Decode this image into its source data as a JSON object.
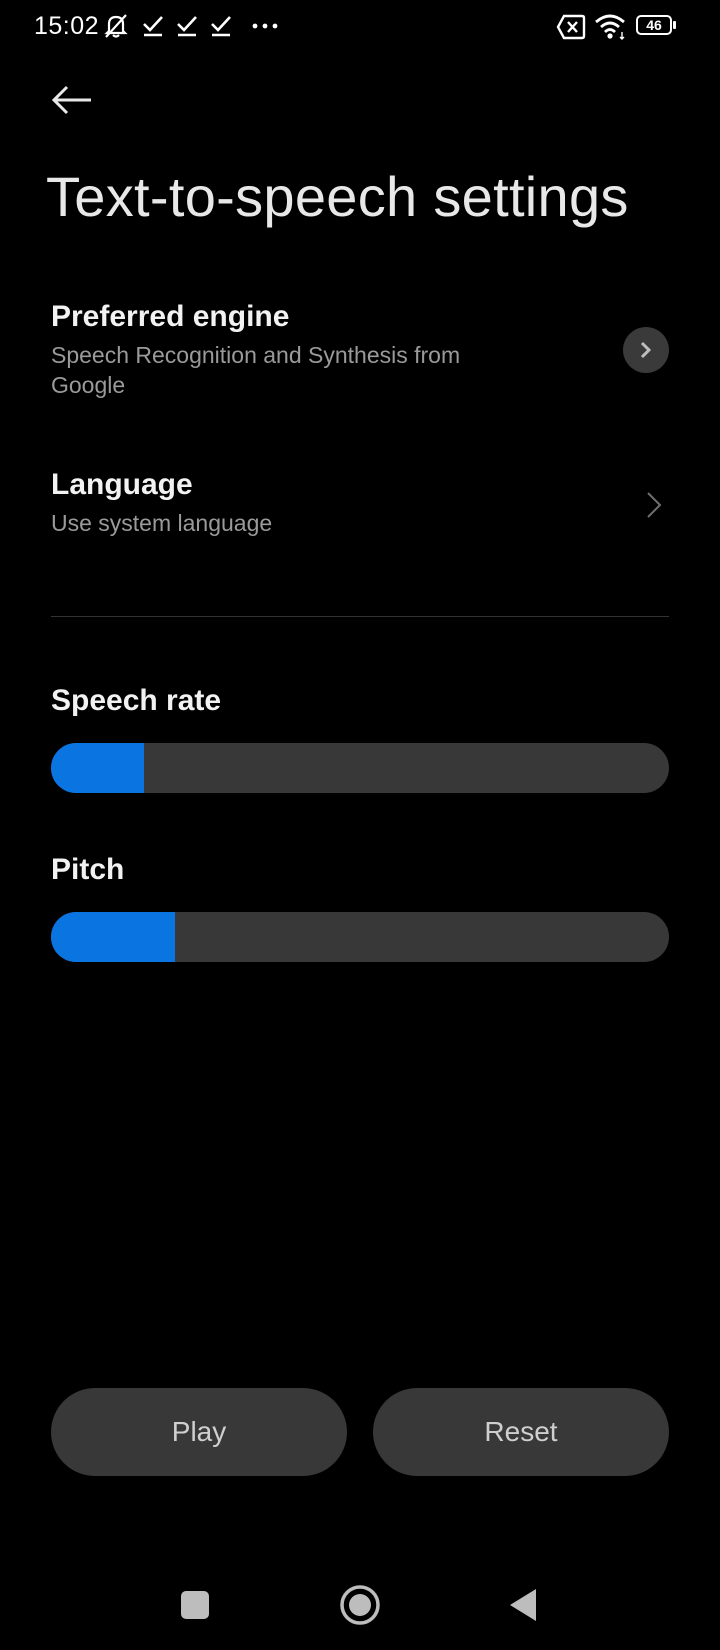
{
  "status_bar": {
    "time": "15:02",
    "battery": "46",
    "left_icons": [
      "muted-bell-icon",
      "check-icon",
      "check-icon",
      "check-icon",
      "more-dots-icon"
    ],
    "right_icons": [
      "sim-x-icon",
      "wifi-icon",
      "battery-icon"
    ]
  },
  "header": {
    "title": "Text-to-speech settings"
  },
  "settings": {
    "preferred_engine": {
      "title": "Preferred engine",
      "value": "Speech Recognition and Synthesis from Google"
    },
    "language": {
      "title": "Language",
      "value": "Use system language"
    }
  },
  "sliders": {
    "speech_rate": {
      "label": "Speech rate",
      "value_fraction": 0.15
    },
    "pitch": {
      "label": "Pitch",
      "value_fraction": 0.2
    }
  },
  "buttons": {
    "play": "Play",
    "reset": "Reset"
  },
  "colors": {
    "accent": "#0a74e0",
    "background": "#000000",
    "track": "#383838"
  }
}
